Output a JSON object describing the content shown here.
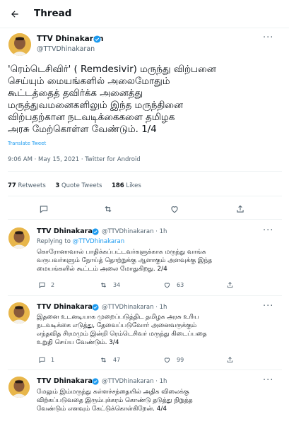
{
  "header": {
    "title": "Thread"
  },
  "main_tweet": {
    "name": "TTV Dhinakaran",
    "handle": "@TTVDhinakaran",
    "text": "'ரெம்டெசிவிர்' ( Remdesivir) மருந்து விற்பனை\nசெய்யும் மையங்களில் அலைமோதும்\nகூட்டத்தைத் தவிர்க்க அனைத்து\nமருத்துவமனைகளிலும் இந்த மருந்தினை\nவிற்பதற்கான நடவடிக்கைகளை தமிழக\nஅரசு மேற்கொள்ள வேண்டும். 1/4",
    "translate": "Translate Tweet",
    "time": "9:06 AM · May 15, 2021 · Twitter for Android",
    "retweets": "77",
    "retweets_label": "Retweets",
    "quotes": "3",
    "quotes_label": "Quote Tweets",
    "likes": "186",
    "likes_label": "Likes"
  },
  "replies": [
    {
      "name": "TTV Dhinakaran",
      "handle_time": "@TTVDhinakaran · 1h",
      "replying_prefix": "Replying to",
      "replying_to": "@TTVDhinakaran",
      "text": "கொரோனாவால் பாதிக்கப்பட்டவர்களுக்காக மருந்து வாங்க\nவருபவர்களும் நோய்த் தொற்றுக்கு ஆளாகும் அளவுக்கு இந்த\nமையங்களில் கூட்டம் அலை மோதுகிறது. 2/4",
      "reply_count": "2",
      "retweet_count": "34",
      "like_count": "63"
    },
    {
      "name": "TTV Dhinakaran",
      "handle_time": "@TTVDhinakaran · 1h",
      "text": "இதனை உடனடியாக முறைப்படுத்திட தமிழக அரசு உரிய\nநடவடிக்கை எடுத்து, தேவைப்படுவோர் அனைவருக்கும்\nஎந்தவித சிரமமும் இன்றி ரெம்டெசிவர் மருந்து கிடைப்பதை\nஉறுதி செய்ய வேண்டும். 3/4",
      "reply_count": "1",
      "retweet_count": "47",
      "like_count": "99"
    },
    {
      "name": "TTV Dhinakaran",
      "handle_time": "@TTVDhinakaran · 1h",
      "text": "மேலும் இம்மருந்து கள்ளச்சந்தையில் அதிக விலைக்கு\nவிற்கப்படுவதை இரும்புக்கரம் கொண்டு தடுத்து நிறுத்த\nவேண்டும் எனவும் கேட்டுக்கொள்கிறேன். 4/4"
    }
  ],
  "colors": {
    "accent": "#1d9bf0",
    "muted": "#536471",
    "divider": "#eff3f4"
  }
}
